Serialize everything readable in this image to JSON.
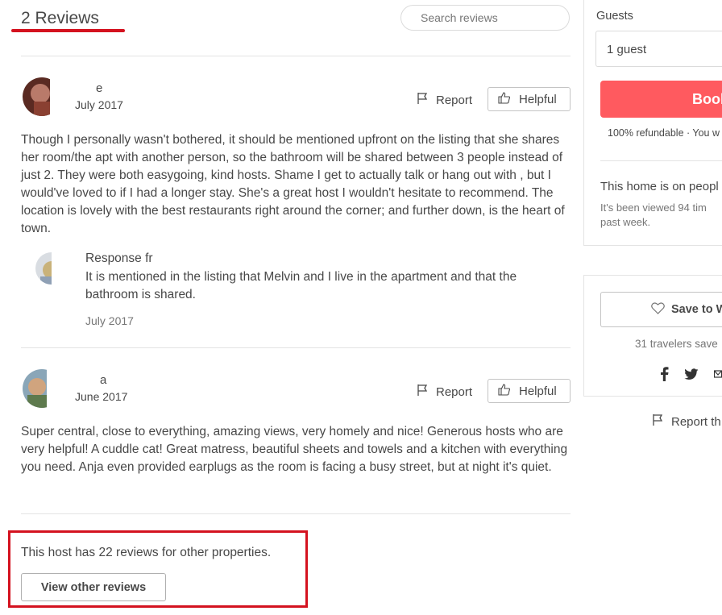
{
  "reviews_header": {
    "title": "2 Reviews",
    "search_placeholder": "Search reviews"
  },
  "reviews": [
    {
      "name": "e",
      "date": "July 2017",
      "report_label": "Report",
      "helpful_label": "Helpful",
      "text": "Though I personally wasn't bothered, it should be mentioned upfront on the listing that she shares her room/the apt with another person, so the bathroom will be shared between 3 people instead of just 2. They were both easygoing, kind hosts. Shame I get to actually talk or hang out with , but I would've loved to if I had a longer stay. She's a great host I wouldn't hesitate to recommend. The location is lovely with the best restaurants right around the corner; and further down, is the heart of town.",
      "response": {
        "title": "Response fr",
        "text": "It is mentioned in the listing that Melvin and I live in the apartment and that the bathroom is shared.",
        "date": "July 2017"
      }
    },
    {
      "name": "a",
      "date": "June 2017",
      "report_label": "Report",
      "helpful_label": "Helpful",
      "text": "Super central, close to everything, amazing views, very homely and nice! Generous hosts who are very helpful! A cuddle cat! Great matress, beautiful sheets and towels and a kitchen with everything you need. Anja even provided earplugs as the room is facing a busy street, but at night it's quiet."
    }
  ],
  "other_reviews": {
    "text": "This host has 22 reviews for other properties.",
    "button_label": "View other reviews"
  },
  "booking": {
    "guests_label": "Guests",
    "guests_value": "1 guest",
    "book_label": "Book",
    "refund_text": "100% refundable · You w",
    "popular_title": "This home is on peopl",
    "viewed_line1": "It's been viewed 94 tim",
    "viewed_line2": "past week."
  },
  "save": {
    "save_label": "Save to W",
    "travelers_text": "31 travelers save",
    "share_icons": [
      "facebook-icon",
      "twitter-icon",
      "email-icon"
    ],
    "report_listing_label": "Report th"
  },
  "colors": {
    "accent": "#ff5a5f",
    "highlight": "#d4121f",
    "text": "#484848",
    "muted": "#767676"
  }
}
